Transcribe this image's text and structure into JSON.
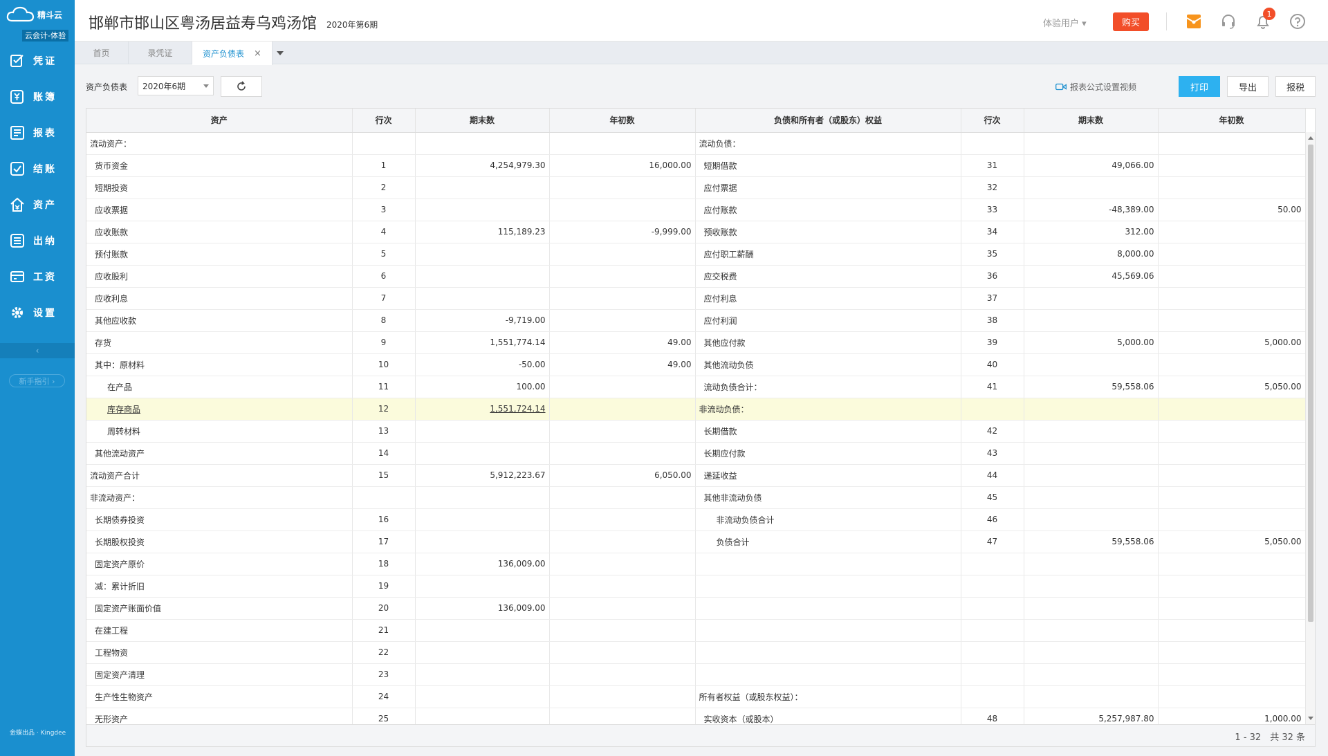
{
  "sidebar": {
    "brand": "精斗云",
    "edition": "云会计-体验",
    "items": [
      {
        "label": "凭证",
        "icon": "voucher-icon"
      },
      {
        "label": "账簿",
        "icon": "ledger-icon"
      },
      {
        "label": "报表",
        "icon": "report-icon"
      },
      {
        "label": "结账",
        "icon": "checkout-icon"
      },
      {
        "label": "资产",
        "icon": "asset-icon"
      },
      {
        "label": "出纳",
        "icon": "cashier-icon"
      },
      {
        "label": "工资",
        "icon": "salary-icon"
      },
      {
        "label": "设置",
        "icon": "gear-icon"
      }
    ],
    "collapse": "‹",
    "guide": "新手指引 ›",
    "footer": "金蝶出品 · Kingdee"
  },
  "header": {
    "company": "邯郸市邯山区粤汤居益寿乌鸡汤馆",
    "period": "2020年第6期",
    "user": "体验用户",
    "buy": "购买",
    "notifications": "1",
    "accent": "#1a8fcf",
    "buy_color": "#f24e29"
  },
  "tabs": [
    {
      "label": "首页"
    },
    {
      "label": "录凭证"
    },
    {
      "label": "资产负债表",
      "active": true,
      "close": "×"
    }
  ],
  "toolbar": {
    "report_label": "资产负债表",
    "period_value": "2020年6期",
    "video_link": "报表公式设置视频",
    "print": "打印",
    "export": "导出",
    "tax": "报税"
  },
  "table": {
    "headers": [
      "资产",
      "行次",
      "期末数",
      "年初数",
      "负债和所有者（或股东）权益",
      "行次",
      "期末数",
      "年初数"
    ],
    "rows": [
      {
        "a": "流动资产：",
        "al": "",
        "ae": "",
        "ab": "",
        "l": "流动负债：",
        "ll": "",
        "le": "",
        "lb": "",
        "ai": 0,
        "li": 0
      },
      {
        "a": "货币资金",
        "al": "1",
        "ae": "4,254,979.30",
        "ab": "16,000.00",
        "l": "短期借款",
        "ll": "31",
        "le": "49,066.00",
        "lb": "",
        "ai": 1,
        "li": 1
      },
      {
        "a": "短期投资",
        "al": "2",
        "ae": "",
        "ab": "",
        "l": "应付票据",
        "ll": "32",
        "le": "",
        "lb": "",
        "ai": 1,
        "li": 1
      },
      {
        "a": "应收票据",
        "al": "3",
        "ae": "",
        "ab": "",
        "l": "应付账款",
        "ll": "33",
        "le": "-48,389.00",
        "lb": "50.00",
        "ai": 1,
        "li": 1
      },
      {
        "a": "应收账款",
        "al": "4",
        "ae": "115,189.23",
        "ab": "-9,999.00",
        "l": "预收账款",
        "ll": "34",
        "le": "312.00",
        "lb": "",
        "ai": 1,
        "li": 1
      },
      {
        "a": "预付账款",
        "al": "5",
        "ae": "",
        "ab": "",
        "l": "应付职工薪酬",
        "ll": "35",
        "le": "8,000.00",
        "lb": "",
        "ai": 1,
        "li": 1
      },
      {
        "a": "应收股利",
        "al": "6",
        "ae": "",
        "ab": "",
        "l": "应交税费",
        "ll": "36",
        "le": "45,569.06",
        "lb": "",
        "ai": 1,
        "li": 1
      },
      {
        "a": "应收利息",
        "al": "7",
        "ae": "",
        "ab": "",
        "l": "应付利息",
        "ll": "37",
        "le": "",
        "lb": "",
        "ai": 1,
        "li": 1
      },
      {
        "a": "其他应收款",
        "al": "8",
        "ae": "-9,719.00",
        "ab": "",
        "l": "应付利润",
        "ll": "38",
        "le": "",
        "lb": "",
        "ai": 1,
        "li": 1
      },
      {
        "a": "存货",
        "al": "9",
        "ae": "1,551,774.14",
        "ab": "49.00",
        "l": "其他应付款",
        "ll": "39",
        "le": "5,000.00",
        "lb": "5,000.00",
        "ai": 1,
        "li": 1
      },
      {
        "a": "其中：原材料",
        "al": "10",
        "ae": "-50.00",
        "ab": "49.00",
        "l": "其他流动负债",
        "ll": "40",
        "le": "",
        "lb": "",
        "ai": 1,
        "li": 1
      },
      {
        "a": "在产品",
        "al": "11",
        "ae": "100.00",
        "ab": "",
        "l": "流动负债合计：",
        "ll": "41",
        "le": "59,558.06",
        "lb": "5,050.00",
        "ai": 2,
        "li": 1
      },
      {
        "a": "库存商品",
        "al": "12",
        "ae": "1,551,724.14",
        "ab": "",
        "l": "非流动负债：",
        "ll": "",
        "le": "",
        "lb": "",
        "ai": 2,
        "li": 0,
        "hl": true
      },
      {
        "a": "周转材料",
        "al": "13",
        "ae": "",
        "ab": "",
        "l": "长期借款",
        "ll": "42",
        "le": "",
        "lb": "",
        "ai": 2,
        "li": 1
      },
      {
        "a": "其他流动资产",
        "al": "14",
        "ae": "",
        "ab": "",
        "l": "长期应付款",
        "ll": "43",
        "le": "",
        "lb": "",
        "ai": 1,
        "li": 1
      },
      {
        "a": "流动资产合计",
        "al": "15",
        "ae": "5,912,223.67",
        "ab": "6,050.00",
        "l": "递延收益",
        "ll": "44",
        "le": "",
        "lb": "",
        "ai": 0,
        "li": 1
      },
      {
        "a": "非流动资产：",
        "al": "",
        "ae": "",
        "ab": "",
        "l": "其他非流动负债",
        "ll": "45",
        "le": "",
        "lb": "",
        "ai": 0,
        "li": 1
      },
      {
        "a": "长期债券投资",
        "al": "16",
        "ae": "",
        "ab": "",
        "l": "非流动负债合计",
        "ll": "46",
        "le": "",
        "lb": "",
        "ai": 1,
        "li": 2
      },
      {
        "a": "长期股权投资",
        "al": "17",
        "ae": "",
        "ab": "",
        "l": "负债合计",
        "ll": "47",
        "le": "59,558.06",
        "lb": "5,050.00",
        "ai": 1,
        "li": 3
      },
      {
        "a": "固定资产原价",
        "al": "18",
        "ae": "136,009.00",
        "ab": "",
        "l": "",
        "ll": "",
        "le": "",
        "lb": "",
        "ai": 1,
        "li": 0
      },
      {
        "a": "减：累计折旧",
        "al": "19",
        "ae": "",
        "ab": "",
        "l": "",
        "ll": "",
        "le": "",
        "lb": "",
        "ai": 1,
        "li": 0
      },
      {
        "a": "固定资产账面价值",
        "al": "20",
        "ae": "136,009.00",
        "ab": "",
        "l": "",
        "ll": "",
        "le": "",
        "lb": "",
        "ai": 1,
        "li": 0
      },
      {
        "a": "在建工程",
        "al": "21",
        "ae": "",
        "ab": "",
        "l": "",
        "ll": "",
        "le": "",
        "lb": "",
        "ai": 1,
        "li": 0
      },
      {
        "a": "工程物资",
        "al": "22",
        "ae": "",
        "ab": "",
        "l": "",
        "ll": "",
        "le": "",
        "lb": "",
        "ai": 1,
        "li": 0
      },
      {
        "a": "固定资产清理",
        "al": "23",
        "ae": "",
        "ab": "",
        "l": "",
        "ll": "",
        "le": "",
        "lb": "",
        "ai": 1,
        "li": 0
      },
      {
        "a": "生产性生物资产",
        "al": "24",
        "ae": "",
        "ab": "",
        "l": "所有者权益（或股东权益）：",
        "ll": "",
        "le": "",
        "lb": "",
        "ai": 1,
        "li": 0
      },
      {
        "a": "无形资产",
        "al": "25",
        "ae": "",
        "ab": "",
        "l": "实收资本（或股本）",
        "ll": "48",
        "le": "5,257,987.80",
        "lb": "1,000.00",
        "ai": 1,
        "li": 1
      }
    ],
    "pager": "1 - 32　共 32 条"
  }
}
